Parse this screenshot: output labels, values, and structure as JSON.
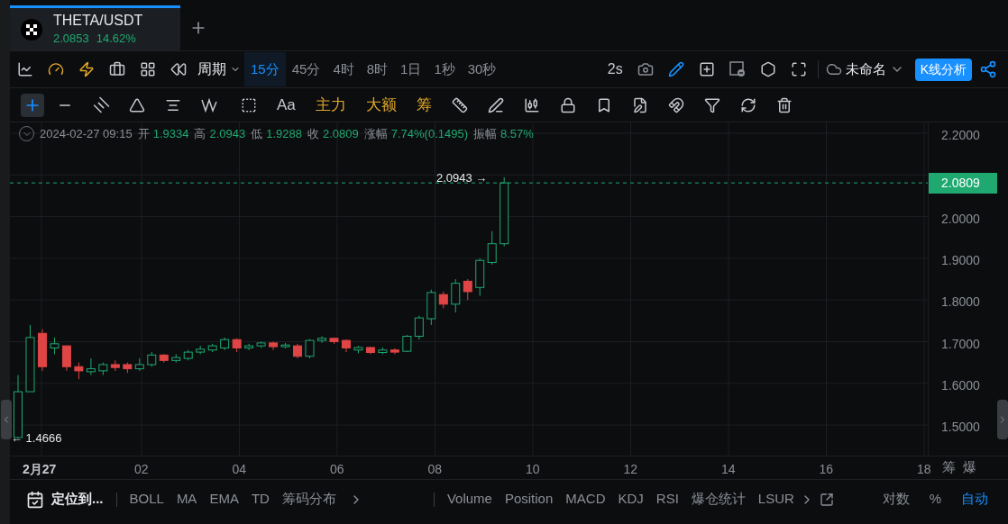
{
  "tab": {
    "symbol": "THETA/USDT",
    "price": "2.0853",
    "change": "14.62%",
    "selected": true
  },
  "toolbar": {
    "period_label": "周期",
    "intervals": [
      {
        "label": "15分",
        "selected": true
      },
      {
        "label": "45分",
        "selected": false
      },
      {
        "label": "4时",
        "selected": false
      },
      {
        "label": "8时",
        "selected": false
      },
      {
        "label": "1日",
        "selected": false
      },
      {
        "label": "1秒",
        "selected": false
      },
      {
        "label": "30秒",
        "selected": false
      }
    ],
    "refresh": "2s",
    "layout_name": "未命名",
    "analysis_button": "K线分析"
  },
  "drawing_tools": {
    "cursor_selected": true,
    "text_tool": "Aa",
    "indicators": [
      "主力",
      "大额",
      "筹"
    ]
  },
  "ohlc": {
    "datetime": "2024-02-27 09:15",
    "fields": [
      {
        "label": "开",
        "value": "1.9334"
      },
      {
        "label": "高",
        "value": "2.0943"
      },
      {
        "label": "低",
        "value": "1.9288"
      },
      {
        "label": "收",
        "value": "2.0809"
      },
      {
        "label": "涨幅",
        "value": "7.74%(0.1495)"
      },
      {
        "label": "振幅",
        "value": "8.57%"
      }
    ]
  },
  "chart": {
    "high_marker": "2.0943 →",
    "low_marker": "← 1.4666",
    "last_price": "2.0809",
    "y_ticks": [
      "2.2000",
      "2.0000",
      "1.9000",
      "1.8000",
      "1.7000",
      "1.6000",
      "1.5000"
    ],
    "x_ticks": [
      "2月27",
      "02",
      "04",
      "06",
      "08",
      "10",
      "12",
      "14",
      "16",
      "18"
    ],
    "axis_buttons": [
      "筹",
      "爆"
    ]
  },
  "bottom_bar": {
    "locate": "定位到...",
    "overlays": [
      "BOLL",
      "MA",
      "EMA",
      "TD",
      "筹码分布"
    ],
    "indicators": [
      "Volume",
      "Position",
      "MACD",
      "KDJ",
      "RSI",
      "爆仓统计",
      "LSUR"
    ],
    "scale_options": [
      {
        "label": "对数",
        "selected": false
      },
      {
        "label": "%",
        "selected": false
      },
      {
        "label": "自动",
        "selected": true
      }
    ]
  }
}
